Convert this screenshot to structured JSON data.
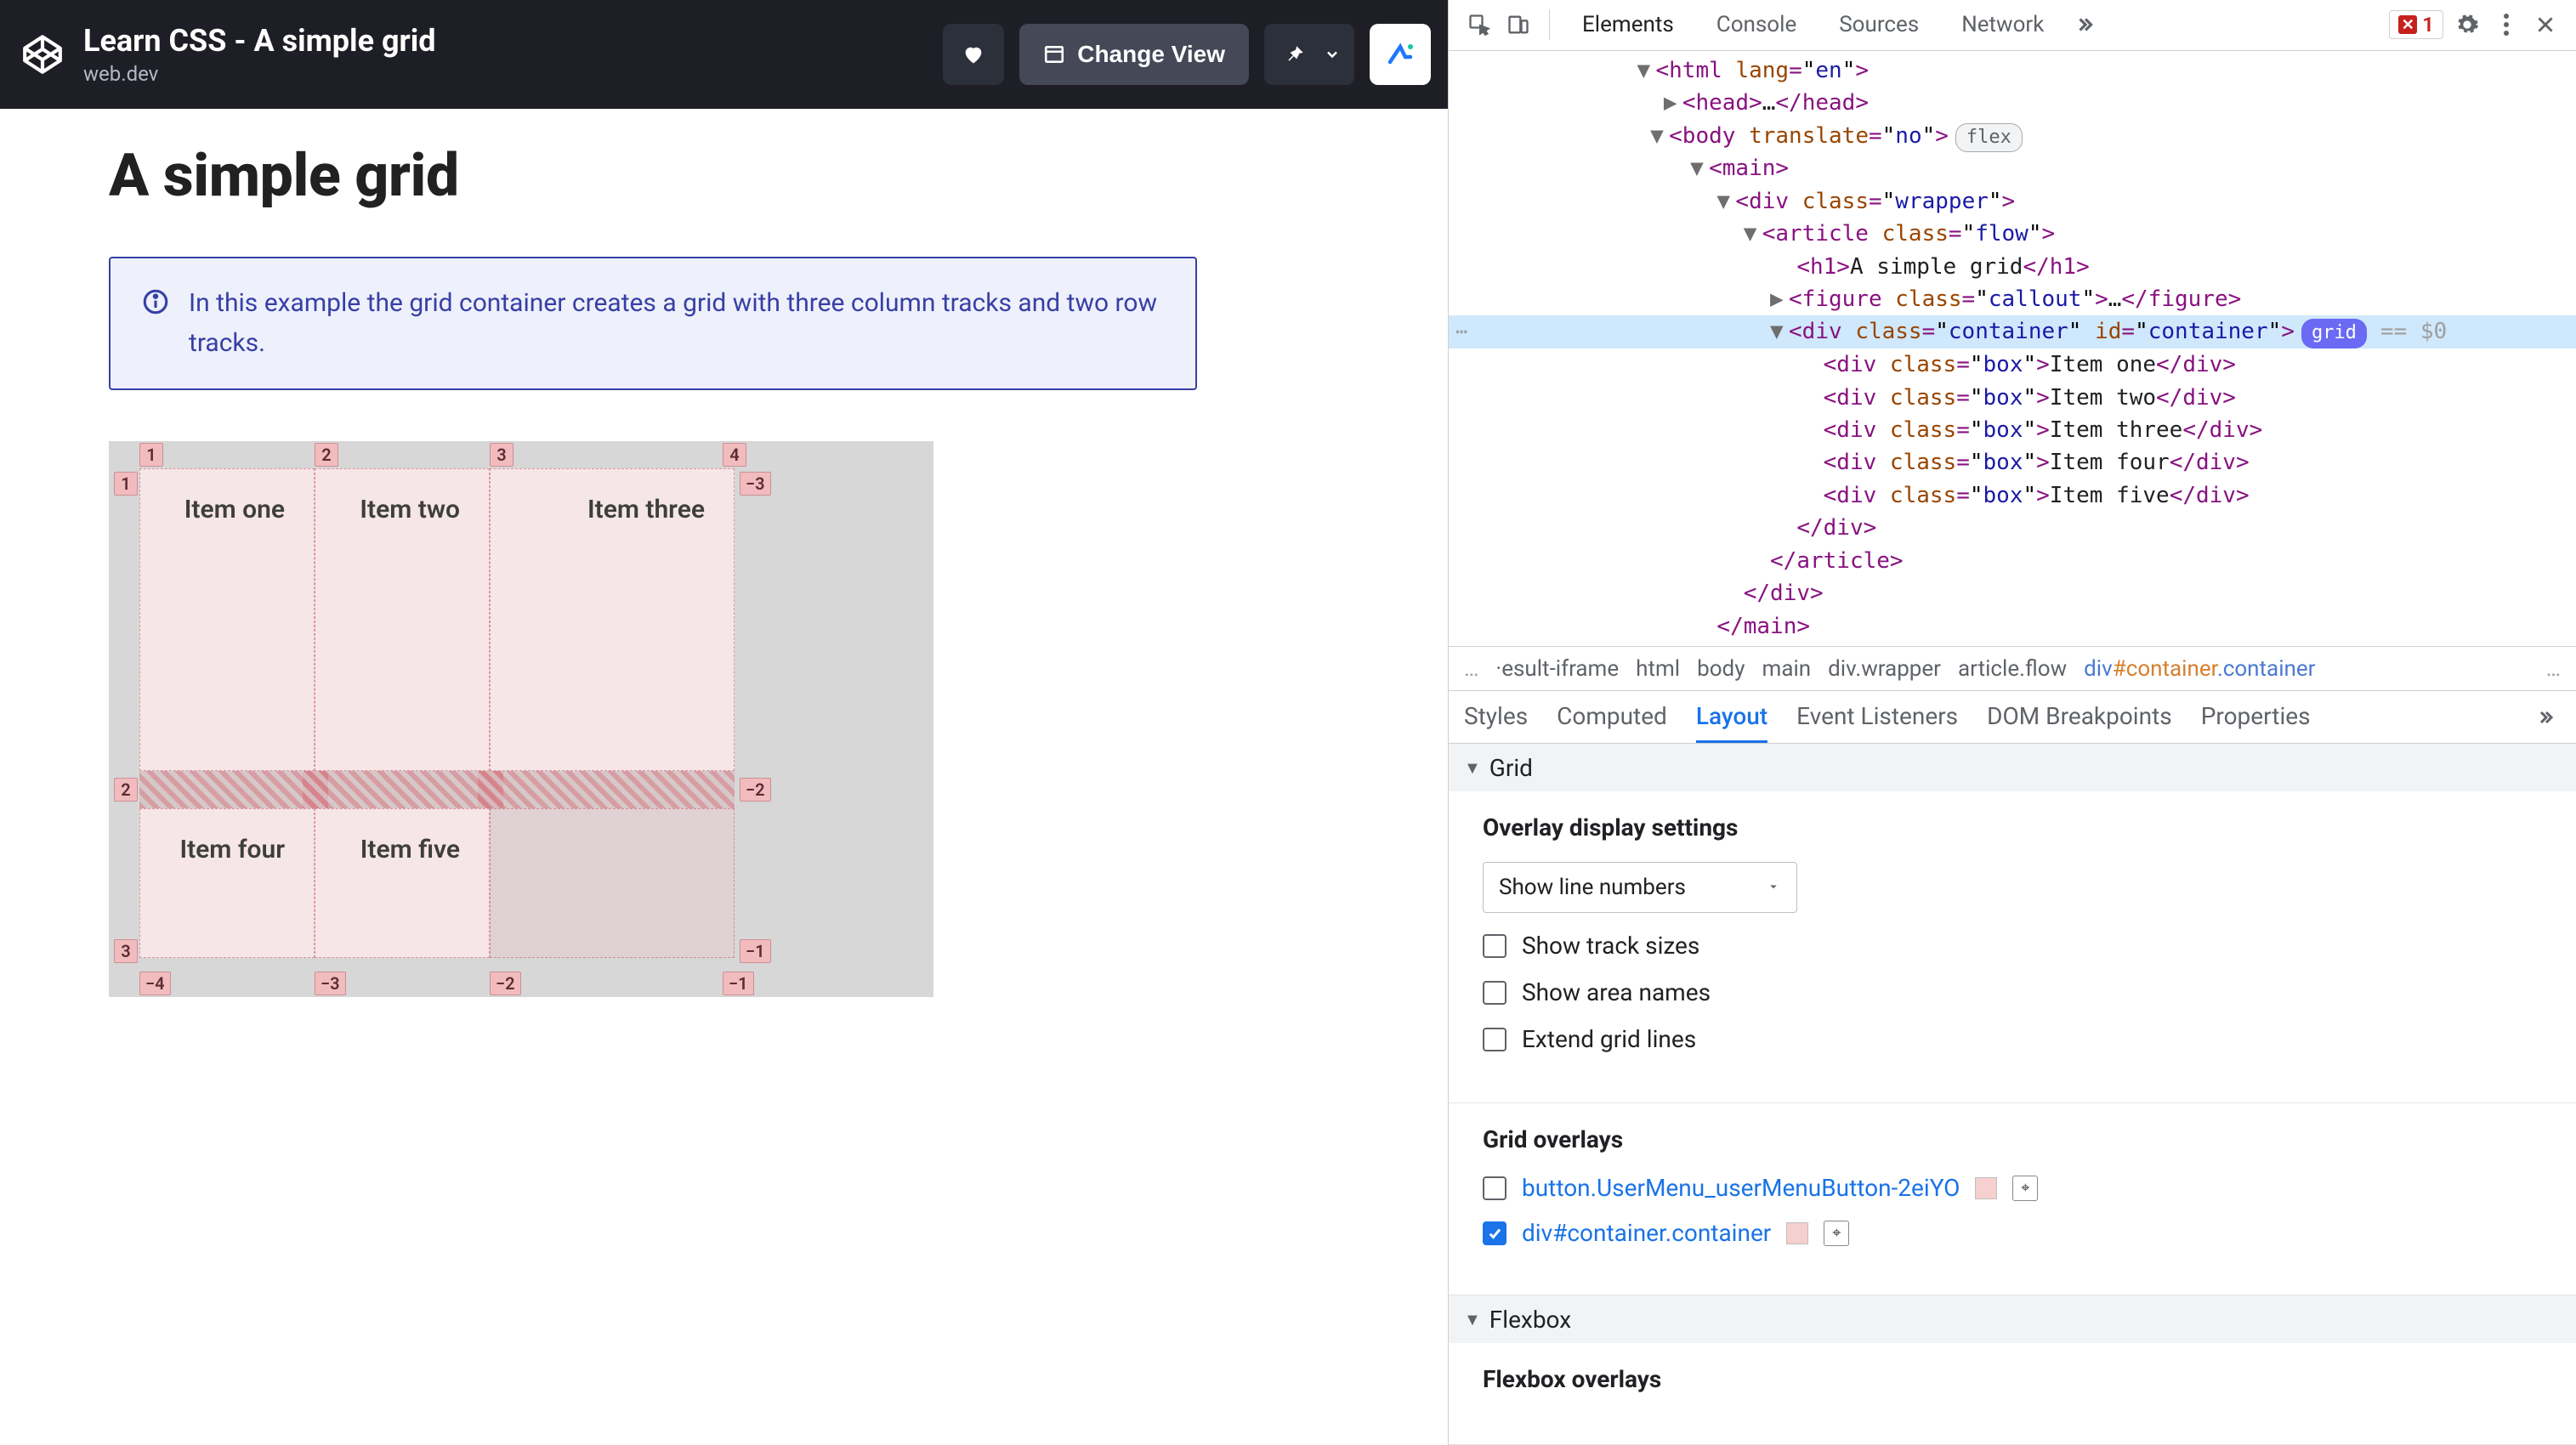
{
  "codepen": {
    "title": "Learn CSS - A simple grid",
    "subtitle": "web.dev",
    "change_view": "Change View"
  },
  "preview": {
    "h1": "A simple grid",
    "callout": "In this example the grid container creates a grid with three column tracks and two row tracks.",
    "items": [
      "Item one",
      "Item two",
      "Item three",
      "Item four",
      "Item five"
    ],
    "line_numbers": {
      "cols_top": [
        "1",
        "2",
        "3",
        "4"
      ],
      "rows_left": [
        "1",
        "2",
        "3"
      ],
      "cols_bottom": [
        "−4",
        "−3",
        "−2",
        "−1"
      ],
      "rows_right": [
        "−3",
        "−2",
        "−1"
      ]
    }
  },
  "devtools": {
    "tabs": [
      "Elements",
      "Console",
      "Sources",
      "Network"
    ],
    "error_count": "1",
    "dom": {
      "html_lang_attr": "lang",
      "html_lang_val": "en",
      "head_tag": "head",
      "body_open_attr": "translate",
      "body_open_val": "no",
      "main": "main",
      "wrapper_cls": "wrapper",
      "article_cls": "flow",
      "h1_text": "A simple grid",
      "callout_cls": "callout",
      "container_cls": "container",
      "container_id": "container",
      "grid_badge": "grid",
      "flex_badge": "flex",
      "eq0": "== $0",
      "box_cls": "box",
      "boxes": [
        "Item one",
        "Item two",
        "Item three",
        "Item four",
        "Item five"
      ]
    },
    "breadcrumbs": {
      "ell": "…",
      "items": [
        "·esult-iframe",
        "html",
        "body",
        "main",
        "div.wrapper",
        "article.flow"
      ],
      "active_prefix": "div",
      "active_id": "#container",
      "active_cls": ".container"
    },
    "subtabs": [
      "Styles",
      "Computed",
      "Layout",
      "Event Listeners",
      "DOM Breakpoints",
      "Properties"
    ],
    "layout": {
      "grid_header": "Grid",
      "overlay_title": "Overlay display settings",
      "select_value": "Show line numbers",
      "chk_track": "Show track sizes",
      "chk_area": "Show area names",
      "chk_extend": "Extend grid lines",
      "overlays_title": "Grid overlays",
      "ov1": "button.UserMenu_userMenuButton-2eiYO",
      "ov2": "div#container.container",
      "flexbox_header": "Flexbox",
      "flex_overlays_title": "Flexbox overlays"
    }
  }
}
